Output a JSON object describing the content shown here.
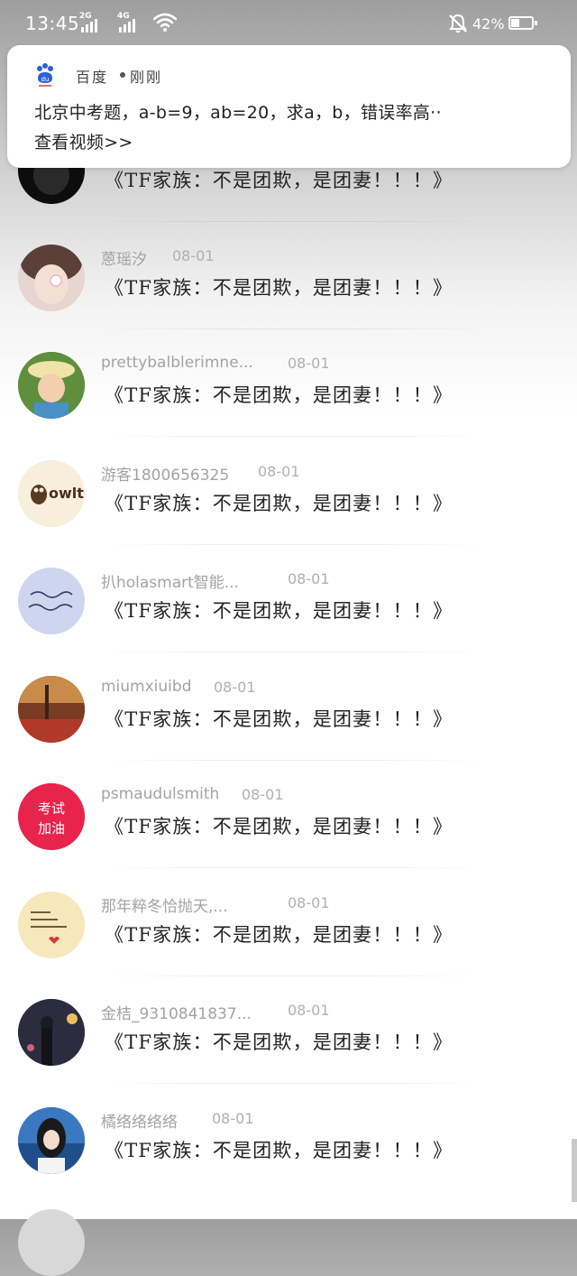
{
  "status_bar": {
    "time": "13:45",
    "network_1": "2G",
    "network_2": "4G",
    "battery": "42%",
    "battery_level": 0.42,
    "icons": [
      "wifi-icon",
      "mute-icon",
      "battery-icon"
    ]
  },
  "notification": {
    "app_name": "百度",
    "time": "刚刚",
    "title": "北京中考题，a-b=9，ab=20，求a，b，错误率高··",
    "link": "查看视频>>",
    "app_icon": "baidu-paw-icon",
    "accent_color": "#2b5fd9"
  },
  "comments": [
    {
      "username": "",
      "date": "",
      "text": "《TF家族：不是团欺，是团妻！！！》",
      "avatar_color": "#111111"
    },
    {
      "username": "蒽瑶汐",
      "date": "08-01",
      "text": "《TF家族：不是团欺，是团妻！！！》",
      "avatar_color": "#e9dcd8"
    },
    {
      "username": "prettybalblerimne...",
      "date": "08-01",
      "text": "《TF家族：不是团欺，是团妻！！！》",
      "avatar_color": "#5c8a3a"
    },
    {
      "username": "游客1800656325",
      "date": "08-01",
      "text": "《TF家族：不是团欺，是团妻！！！》",
      "avatar_color": "#f6ecd8",
      "avatar_text": "owlt"
    },
    {
      "username": "扒holasmart智能...",
      "date": "08-01",
      "text": "《TF家族：不是团欺，是团妻！！！》",
      "avatar_color": "#c9d2ec"
    },
    {
      "username": "miumxiuibd",
      "date": "08-01",
      "text": "《TF家族：不是团欺，是团妻！！！》",
      "avatar_color": "#9a4a2a"
    },
    {
      "username": "psmaudulsmith",
      "date": "08-01",
      "text": "《TF家族：不是团欺，是团妻！！！》",
      "avatar_color": "#e8234c",
      "avatar_text": "考试加油"
    },
    {
      "username": "那年粹冬恰抛天,...",
      "date": "08-01",
      "text": "《TF家族：不是团欺，是团妻！！！》",
      "avatar_color": "#f6e6b8"
    },
    {
      "username": "金桔_9310841837...",
      "date": "08-01",
      "text": "《TF家族：不是团欺，是团妻！！！》",
      "avatar_color": "#2a2a38"
    },
    {
      "username": "橘络络络络",
      "date": "08-01",
      "text": "《TF家族：不是团欺，是团妻！！！》",
      "avatar_color": "#2f6fb8"
    }
  ]
}
